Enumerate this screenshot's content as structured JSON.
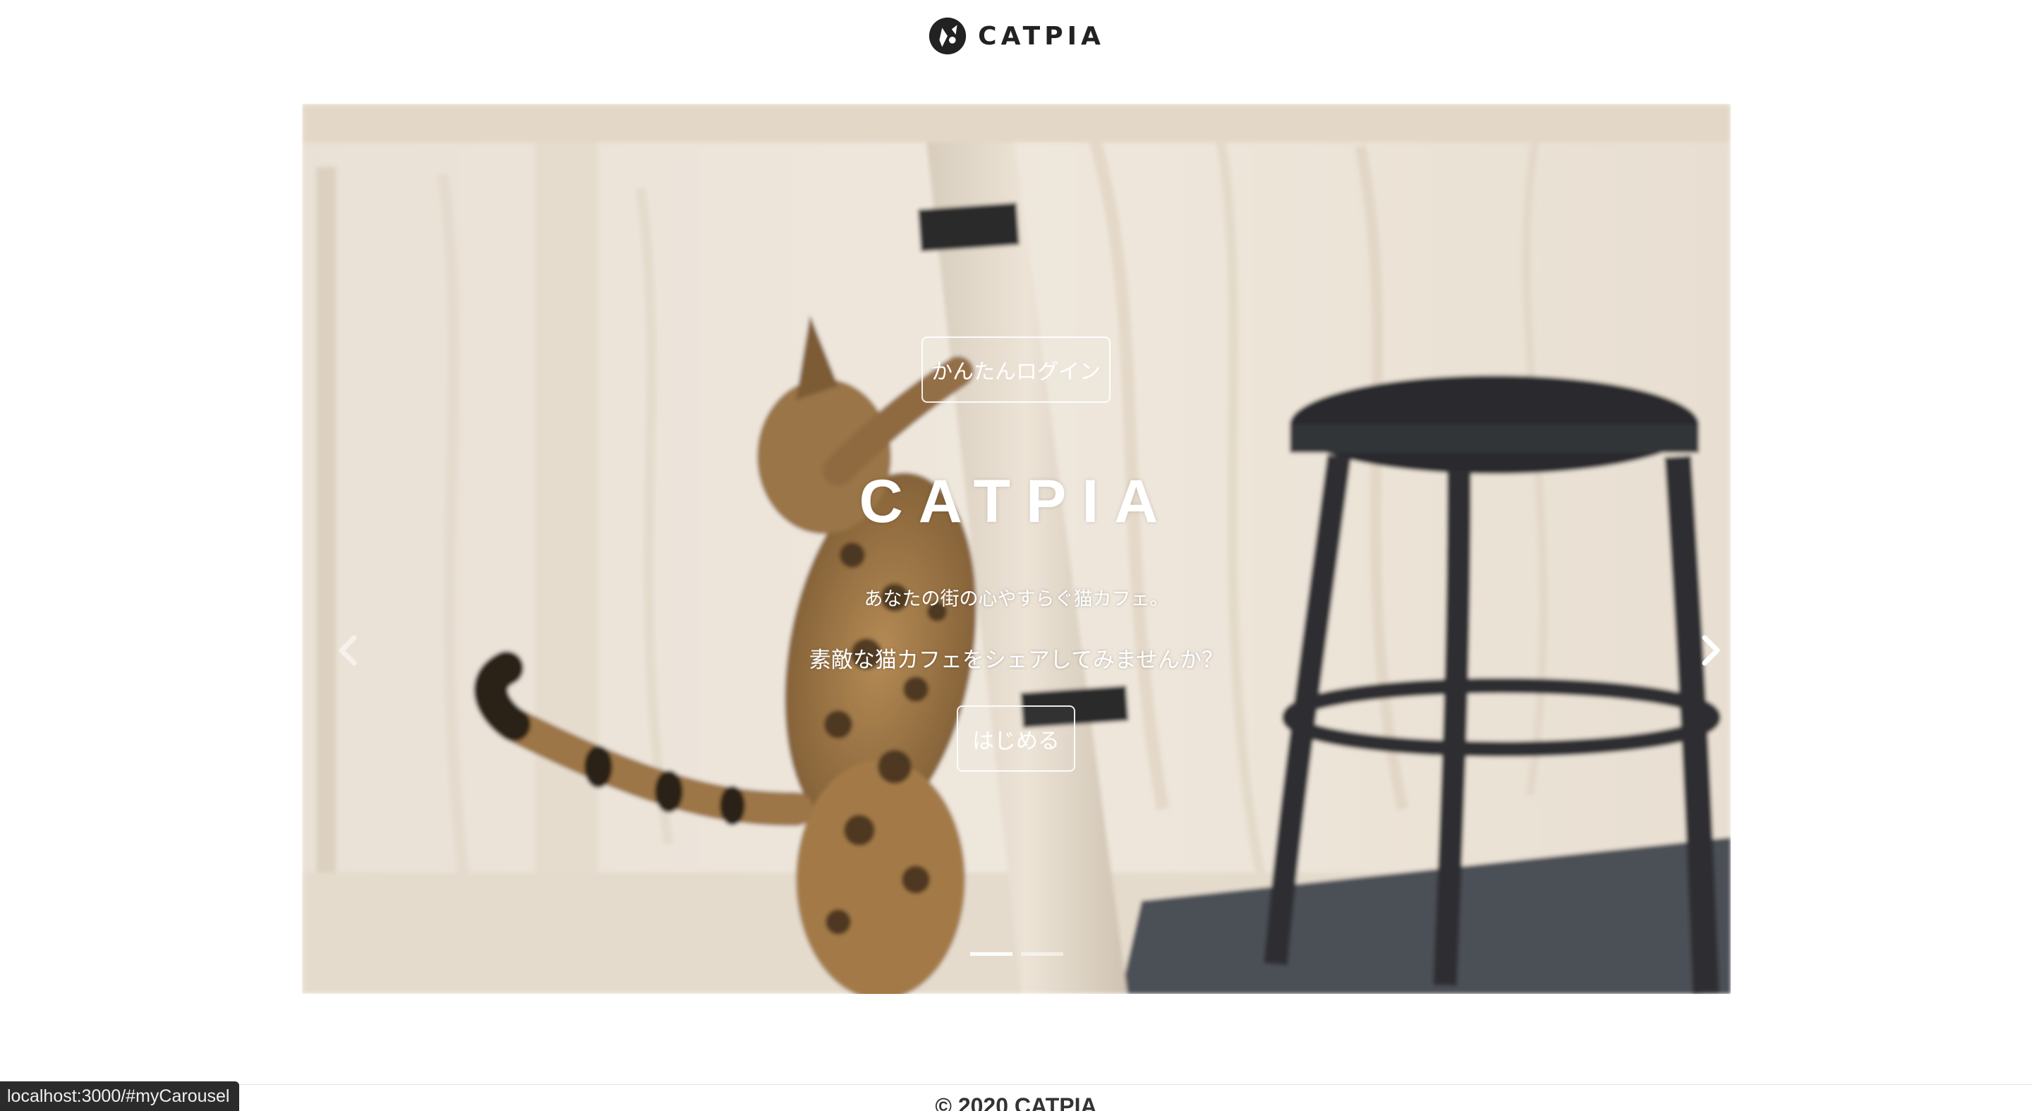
{
  "header": {
    "logo_text": "CATPIA"
  },
  "hero": {
    "login_button": "かんたんログイン",
    "title": "CATPIA",
    "subtitle_1": "あなたの街の心やすらぐ猫カフェ。",
    "subtitle_2": "素敵な猫カフェをシェアしてみませんか？",
    "start_button": "はじめる"
  },
  "carousel": {
    "indicators": [
      {
        "active": true
      },
      {
        "active": false
      }
    ],
    "prev_icon": "chevron-left-icon",
    "next_icon": "chevron-right-icon"
  },
  "footer": {
    "copyright": "© 2020 CATPIA"
  },
  "status_bar": {
    "url": "localhost:3000/#myCarousel"
  },
  "colors": {
    "text_dark": "#222222",
    "overlay_text": "#ffffff",
    "status_bar_bg": "#2b2b2b"
  }
}
